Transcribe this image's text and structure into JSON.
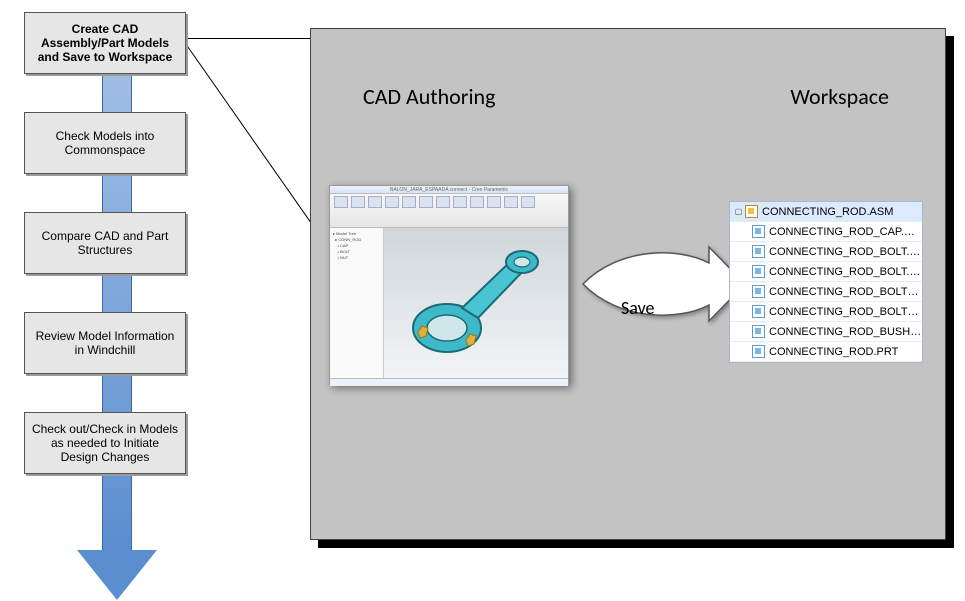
{
  "flow": {
    "steps": [
      "Create CAD Assembly/Part Models and Save to Workspace",
      "Check Models into Commonspace",
      "Compare CAD and Part Structures",
      "Review Model Information in Windchill",
      "Check out/Check in Models as needed to Initiate Design Changes"
    ],
    "active_index": 0
  },
  "panel": {
    "left_heading": "CAD Authoring",
    "right_heading": "Workspace",
    "arrow_label": "Save"
  },
  "cad_window": {
    "title": "BALON_JARA_ESPAADA connect - Creo Parametric"
  },
  "workspace_tree": {
    "parent": {
      "label": "CONNECTING_ROD.ASM",
      "type": "asm"
    },
    "children": [
      {
        "label": "CONNECTING_ROD_CAP.PRT",
        "type": "prt"
      },
      {
        "label": "CONNECTING_ROD_BOLT.PRT",
        "type": "prt"
      },
      {
        "label": "CONNECTING_ROD_BOLT.PRT",
        "type": "prt"
      },
      {
        "label": "CONNECTING_ROD_BOLT_NUT.PRT",
        "type": "prt"
      },
      {
        "label": "CONNECTING_ROD_BOLT_NUT.PRT",
        "type": "prt"
      },
      {
        "label": "CONNECTING_ROD_BUSHING.PRT",
        "type": "prt"
      },
      {
        "label": "CONNECTING_ROD.PRT",
        "type": "prt"
      }
    ]
  }
}
